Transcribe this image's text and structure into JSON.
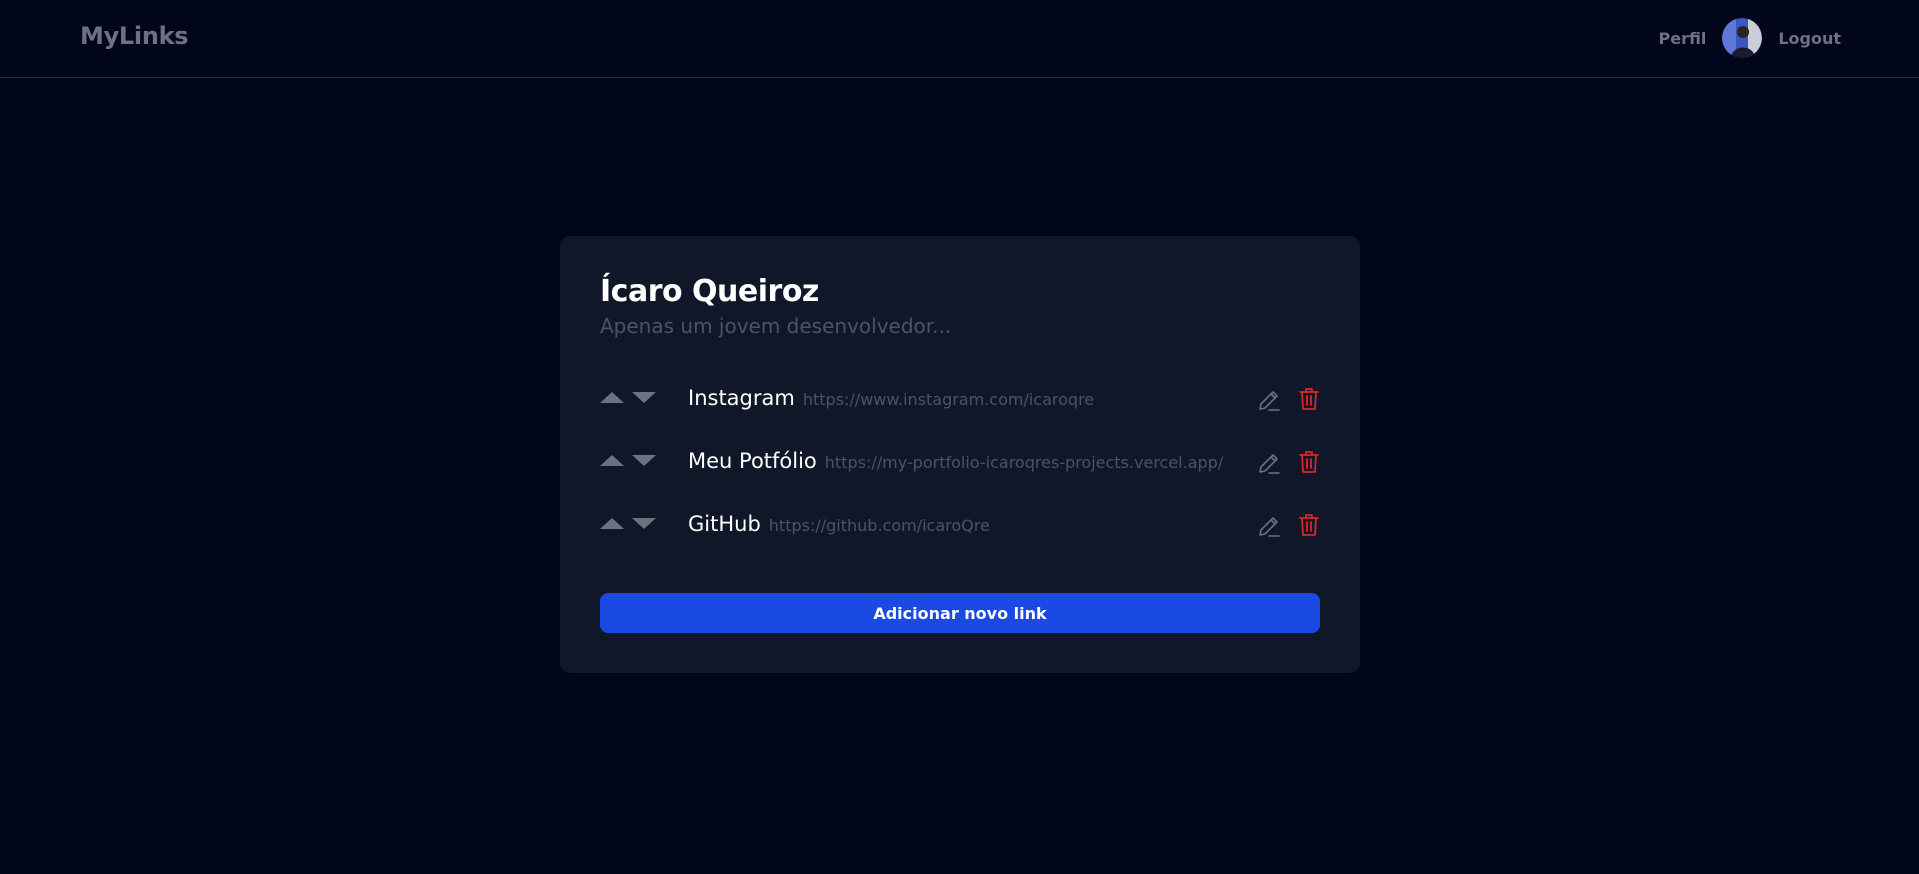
{
  "navbar": {
    "brand": "MyLinks",
    "profile_label": "Perfil",
    "logout_label": "Logout",
    "avatar_icon": "user-avatar"
  },
  "profile": {
    "name": "Ícaro Queiroz",
    "bio": "Apenas um jovem desenvolvedor..."
  },
  "links": [
    {
      "title": "Instagram",
      "url": "https://www.instagram.com/icaroqre"
    },
    {
      "title": "Meu Potfólio",
      "url": "https://my-portfolio-icaroqres-projects.vercel.app/"
    },
    {
      "title": "GitHub",
      "url": "https://github.com/icaroQre"
    }
  ],
  "row_icons": {
    "move_up": "arrow-up-icon",
    "move_down": "arrow-down-icon",
    "edit": "pencil-icon",
    "delete": "trash-icon"
  },
  "actions": {
    "add_link_label": "Adicionar novo link"
  },
  "colors": {
    "background": "#02061a",
    "card": "#0f1729",
    "accent": "#1a49e4",
    "danger": "#dc2626",
    "muted": "#6b7280"
  }
}
